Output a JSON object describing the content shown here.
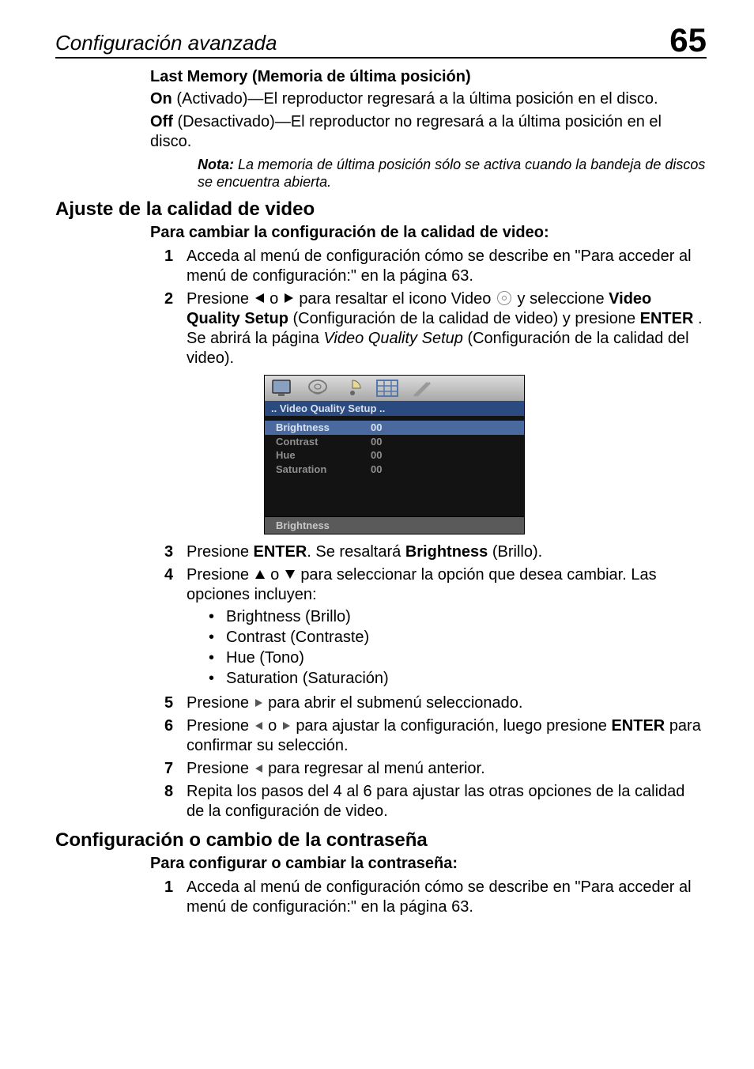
{
  "header": {
    "section": "Configuración avanzada",
    "page": "65"
  },
  "lastMemory": {
    "heading": "Last Memory (Memoria de última posición)",
    "onLabel": "On",
    "onText": " (Activado)—El reproductor regresará a la última posición en el disco.",
    "offLabel": "Off",
    "offText": " (Desactivado)—El reproductor no regresará a la última posición en el disco.",
    "noteLabel": "Nota:",
    "noteText": " La memoria de última posición sólo se activa cuando la bandeja de discos se encuentra abierta."
  },
  "videoQuality": {
    "heading": "Ajuste de la calidad de video",
    "subheading": "Para cambiar la configuración de la calidad de video:",
    "steps": {
      "s1": "Acceda al menú de configuración cómo se describe en \"Para acceder al menú de configuración:\" en la página 63.",
      "s2a": "Presione ",
      "s2b": " o ",
      "s2c": " para resaltar el icono Video ",
      "s2d": " y seleccione ",
      "s2e": "Video Quality Setup",
      "s2f": " (Configuración de la calidad de video) y presione ",
      "s2g": "ENTER",
      "s2h": ". Se abrirá la página ",
      "s2i": "Video Quality Setup",
      "s2j": " (Configuración de la calidad del video).",
      "s3a": "Presione ",
      "s3b": "ENTER",
      "s3c": ". Se resaltará ",
      "s3d": "Brightness",
      "s3e": " (Brillo).",
      "s4a": "Presione ",
      "s4b": " o ",
      "s4c": " para seleccionar la opción que desea cambiar. Las opciones incluyen:",
      "opt1": "Brightness (Brillo)",
      "opt2": "Contrast (Contraste)",
      "opt3": "Hue (Tono)",
      "opt4": "Saturation (Saturación)",
      "s5a": "Presione ",
      "s5b": " para abrir el submenú seleccionado.",
      "s6a": "Presione ",
      "s6b": " o ",
      "s6c": " para ajustar la configuración, luego presione ",
      "s6d": "ENTER",
      "s6e": " para confirmar su selección.",
      "s7a": "Presione ",
      "s7b": " para regresar al menú anterior.",
      "s8": "Repita los pasos del 4 al 6 para ajustar las otras opciones de la calidad de la configuración de video."
    }
  },
  "osd": {
    "title": "..  Video  Quality  Setup   ..",
    "rows": [
      {
        "k": "Brightness",
        "v": "00",
        "sel": true
      },
      {
        "k": "Contrast",
        "v": "00",
        "sel": false
      },
      {
        "k": "Hue",
        "v": "00",
        "sel": false
      },
      {
        "k": "Saturation",
        "v": "00",
        "sel": false
      }
    ],
    "footer": "Brightness"
  },
  "password": {
    "heading": "Configuración o cambio de la contraseña",
    "subheading": "Para configurar o cambiar la contraseña:",
    "s1": "Acceda al menú de configuración cómo se describe en \"Para acceder al menú de configuración:\" en la página 63."
  },
  "nums": {
    "n1": "1",
    "n2": "2",
    "n3": "3",
    "n4": "4",
    "n5": "5",
    "n6": "6",
    "n7": "7",
    "n8": "8"
  }
}
